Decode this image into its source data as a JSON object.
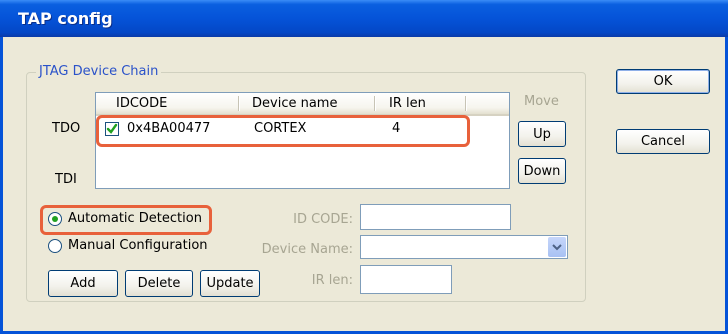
{
  "window": {
    "title": "TAP config"
  },
  "group": {
    "title": "JTAG Device Chain"
  },
  "chain": {
    "tdo_label": "TDO",
    "tdi_label": "TDI"
  },
  "table": {
    "columns": [
      "IDCODE",
      "Device name",
      "IR len"
    ],
    "rows": [
      {
        "checked": true,
        "idcode": "0x4BA00477",
        "device_name": "CORTEX",
        "ir_len": "4"
      }
    ]
  },
  "move": {
    "label": "Move",
    "up": "Up",
    "down": "Down"
  },
  "mode": {
    "automatic": "Automatic Detection",
    "manual": "Manual Configuration",
    "selected": "automatic"
  },
  "fields": {
    "id_code": {
      "label": "ID CODE:",
      "value": ""
    },
    "device_name": {
      "label": "Device Name:",
      "value": ""
    },
    "ir_len": {
      "label": "IR len:",
      "value": ""
    }
  },
  "actions": {
    "add": "Add",
    "delete": "Delete",
    "update": "Update"
  },
  "dialog": {
    "ok": "OK",
    "cancel": "Cancel"
  },
  "colors": {
    "title_bar": "#0553d8",
    "highlight": "#e8613b",
    "check": "#21a121",
    "disabled_text": "#a7a592"
  }
}
